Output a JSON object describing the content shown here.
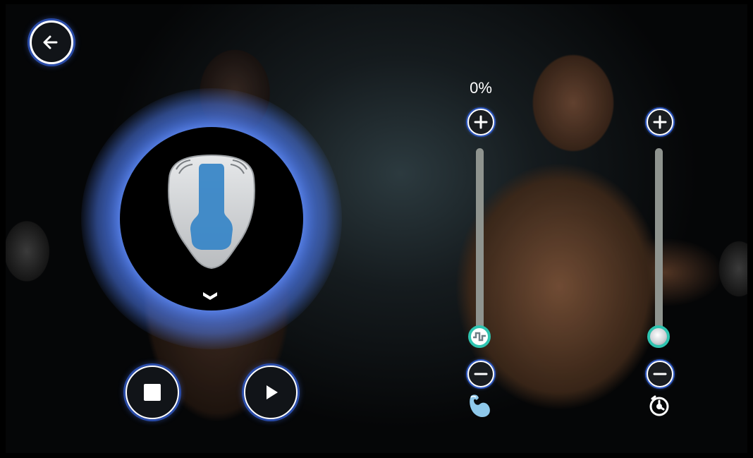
{
  "colors": {
    "accent_blue": "#3d62c9",
    "glow_blue": "#4a76e6",
    "thumb_ring": "#2ec4b0",
    "track": "#8f948f",
    "applicator_blue": "#3a87c7"
  },
  "icons": {
    "back": "arrow-left-icon",
    "stop": "stop-icon",
    "play": "play-icon",
    "chevron": "chevron-down-icon",
    "plus": "plus-icon",
    "minus": "minus-icon",
    "muscle": "muscle-icon",
    "timer": "timer-icon",
    "pulse": "pulse-wave-icon"
  },
  "intensity": {
    "label": "0%",
    "value": 0
  },
  "timer": {
    "value": 0
  }
}
